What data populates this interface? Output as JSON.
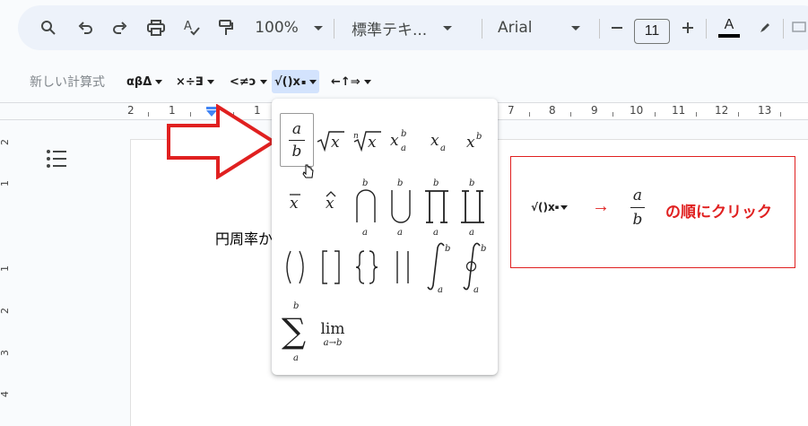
{
  "toolbar": {
    "zoom": "100%",
    "style": "標準テキ...",
    "font": "Arial",
    "font_size": "11",
    "text_color_letter": "A"
  },
  "equation_bar": {
    "new_equation": "新しい計算式",
    "greek": "αβΔ",
    "operators": "×÷∃",
    "relations": "<≠ͻ",
    "math": "√()x",
    "arrows": "←↑⇒"
  },
  "ruler": {
    "numbers": [
      "2",
      "1",
      "1",
      "7",
      "8",
      "9",
      "10",
      "11",
      "12",
      "13"
    ]
  },
  "vruler": {
    "numbers": [
      "2",
      "1",
      "1",
      "2",
      "3",
      "4"
    ]
  },
  "document": {
    "text": "円周率か"
  },
  "dropdown": {
    "frac_num": "a",
    "frac_den": "b",
    "lim": "lim",
    "lim_sub": "a→b"
  },
  "instruction": {
    "menu_label": "√()x",
    "arrow": "→",
    "frac_num": "a",
    "frac_den": "b",
    "hint": "の順にクリック"
  },
  "colors": {
    "accent_red": "#e02020",
    "toolbar_bg": "#edf2fa",
    "active_bg": "#d3e3fd"
  }
}
